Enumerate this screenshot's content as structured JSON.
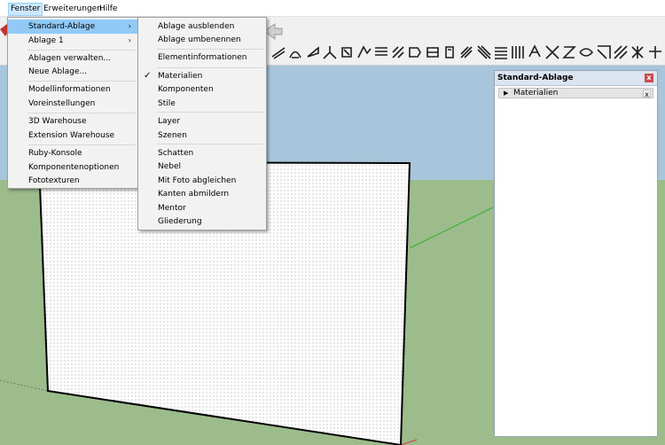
{
  "menubar": {
    "items": [
      {
        "label": "Fenster"
      },
      {
        "label": "Erweiterungen"
      },
      {
        "label": "Hilfe"
      }
    ]
  },
  "fenster_menu": {
    "items": [
      {
        "label": "Standard-Ablage",
        "submenu": true,
        "highlighted": true
      },
      {
        "label": "Ablage 1",
        "submenu": true
      },
      {
        "label": "Ablagen verwalten..."
      },
      {
        "label": "Neue Ablage..."
      },
      {
        "label": "Modellinformationen"
      },
      {
        "label": "Voreinstellungen"
      },
      {
        "label": "3D Warehouse"
      },
      {
        "label": "Extension Warehouse"
      },
      {
        "label": "Ruby-Konsole"
      },
      {
        "label": "Komponentenoptionen"
      },
      {
        "label": "Fototexturen"
      }
    ]
  },
  "submenu": {
    "items": [
      {
        "label": "Ablage ausblenden"
      },
      {
        "label": "Ablage umbenennen"
      },
      {
        "label": "Elementinformationen"
      },
      {
        "label": "Materialien",
        "checked": true
      },
      {
        "label": "Komponenten"
      },
      {
        "label": "Stile"
      },
      {
        "label": "Layer"
      },
      {
        "label": "Szenen"
      },
      {
        "label": "Schatten"
      },
      {
        "label": "Nebel"
      },
      {
        "label": "Mit Foto abgleichen"
      },
      {
        "label": "Kanten abmildern"
      },
      {
        "label": "Mentor"
      },
      {
        "label": "Gliederung"
      }
    ],
    "check_glyph": "✓"
  },
  "tray": {
    "title": "Standard-Ablage",
    "close_glyph": "x",
    "section": {
      "label": "Materialien",
      "expand_glyph": "▶",
      "close_glyph": "x"
    }
  },
  "colors": {
    "sky": "#a7c6dc",
    "ground": "#9cbc8c",
    "menu_highlight": "#91c9f7",
    "menubar_active": "#cce8ff",
    "axis_green": "#2fb02f",
    "axis_red": "#d23c3c",
    "tray_title": "#dbe5f2"
  },
  "toolbar_icons": [
    "dimension-icon",
    "protractor-icon",
    "text-icon",
    "axes-icon",
    "section-plane-icon",
    "sandbox-from-contours-icon",
    "sandbox-from-scratch-icon",
    "smoove-icon",
    "stamp-icon",
    "drape-icon",
    "add-detail-icon",
    "flip-edge-icon",
    "extrude-icon",
    "pattern-icon",
    "pattern-icon",
    "pattern-icon",
    "pattern-icon",
    "pattern-icon",
    "pattern-icon",
    "pattern-icon",
    "pattern-icon",
    "pattern-icon",
    "pattern-icon"
  ]
}
